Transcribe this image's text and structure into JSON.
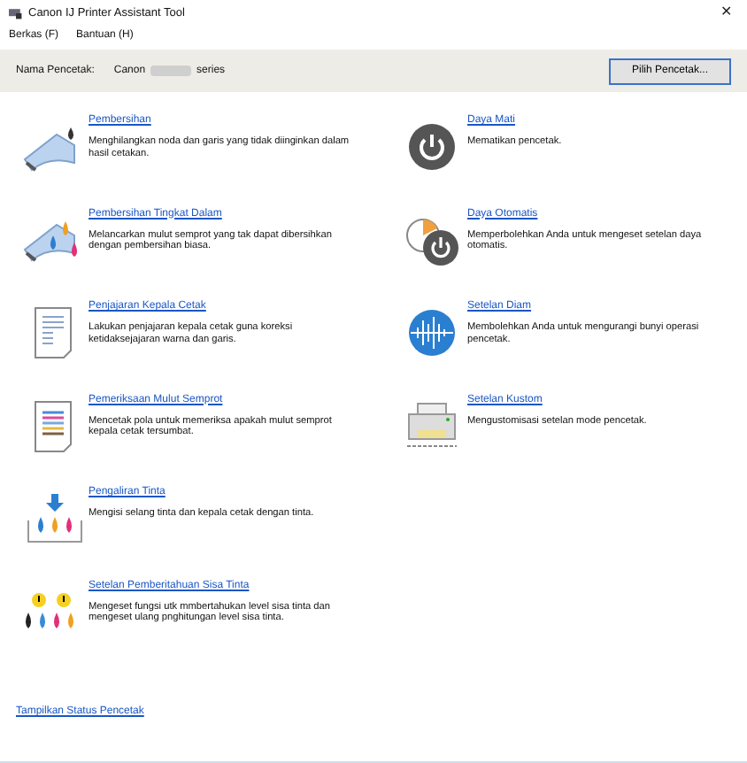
{
  "window": {
    "title": "Canon IJ Printer Assistant Tool",
    "close": "✕"
  },
  "menu": [
    "Berkas (F)",
    "Bantuan (H)"
  ],
  "printer": {
    "label": "Nama Pencetak:",
    "name_start": "Canon",
    "name_end": "series",
    "button": "Pilih Pencetak..."
  },
  "left_items": [
    {
      "kind": "cleaning",
      "title": "Pembersihan",
      "text": "Menghilangkan noda dan garis yang tidak diinginkan dalam hasil cetakan."
    },
    {
      "kind": "deep-cleaning",
      "title": "Pembersihan Tingkat Dalam",
      "text": "Melancarkan mulut semprot yang tak dapat dibersihkan dengan pembersihan biasa."
    },
    {
      "kind": "alignment",
      "title": "Penjajaran Kepala Cetak",
      "text": "Lakukan penjajaran kepala cetak guna koreksi ketidaksejajaran warna dan garis."
    },
    {
      "kind": "nozzle-check",
      "title": "Pemeriksaan Mulut Semprot",
      "text": "Mencetak pola untuk memeriksa apakah mulut semprot kepala cetak tersumbat."
    },
    {
      "kind": "ink-flush",
      "title": "Pengaliran Tinta",
      "text": "Mengisi selang tinta dan kepala cetak dengan tinta."
    },
    {
      "kind": "ink-warning",
      "title": "Setelan Pemberitahuan Sisa Tinta",
      "text": "Mengeset fungsi utk mmbertahukan level sisa tinta dan mengeset ulang pnghitungan level sisa tinta."
    }
  ],
  "right_items": [
    {
      "kind": "power",
      "title": "Daya Mati",
      "text": "Mematikan pencetak."
    },
    {
      "kind": "auto-power",
      "title": "Daya Otomatis",
      "text": "Memperbolehkan Anda untuk mengeset setelan daya otomatis."
    },
    {
      "kind": "quiet",
      "title": "Setelan Diam",
      "text": "Membolehkan Anda untuk mengurangi bunyi operasi pencetak."
    },
    {
      "kind": "custom",
      "title": "Setelan Kustom",
      "text": "Mengustomisasi setelan mode pencetak."
    }
  ],
  "status_link": "Tampilkan Status Pencetak"
}
